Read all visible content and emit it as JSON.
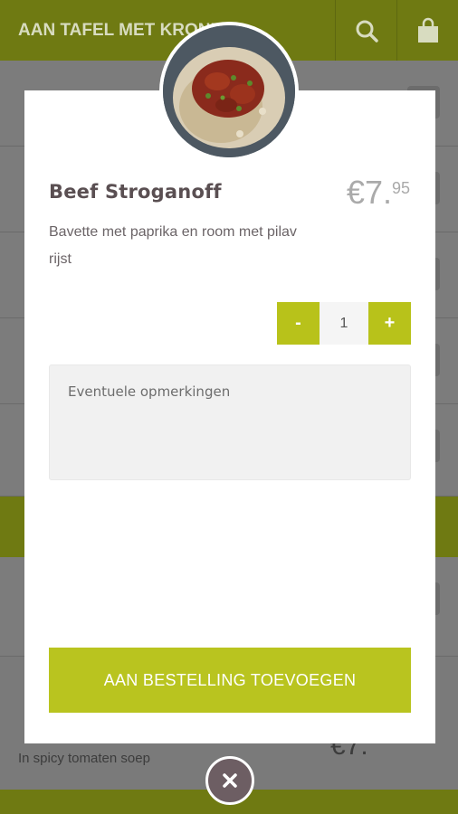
{
  "app": {
    "title": "AAN TAFEL MET KRONIJK",
    "search_icon": "search-icon",
    "cart_icon": "shopping-bag-icon"
  },
  "background": {
    "last_item_desc": "In spicy tomaten soep",
    "last_item_price": "€7."
  },
  "modal": {
    "dish_name": "Beef Stroganoff",
    "price_main": "€7.",
    "price_cents": "95",
    "description": "Bavette met paprika en room met pilav rijst",
    "quantity": {
      "minus_label": "-",
      "value": "1",
      "plus_label": "+"
    },
    "remarks_placeholder": "Eventuele opmerkingen",
    "add_button_label": "AAN BESTELLING TOEVOEGEN",
    "close_icon": "close-icon"
  },
  "colors": {
    "brand": "#b9c41f",
    "close": "#6d5e63"
  }
}
